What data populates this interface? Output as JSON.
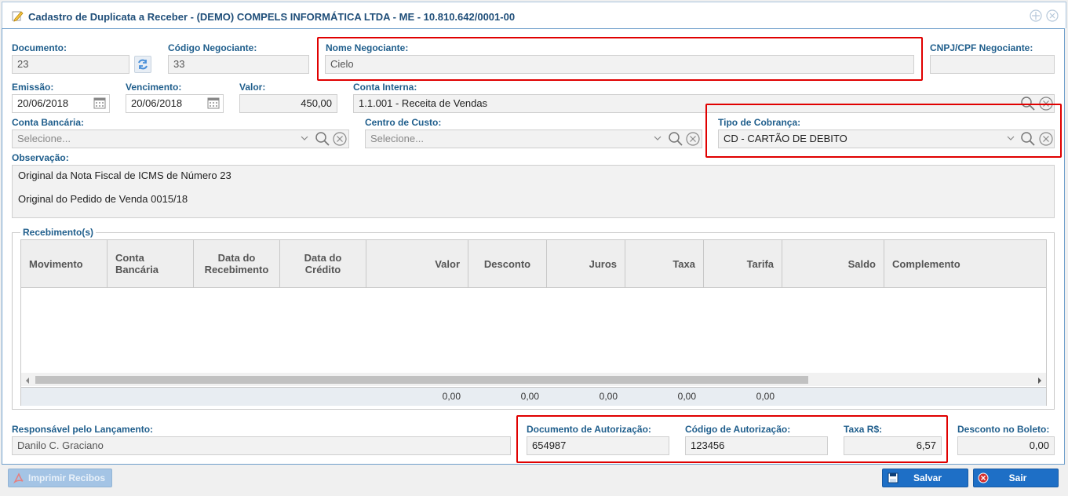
{
  "window": {
    "title": "Cadastro de Duplicata a Receber - (DEMO) COMPELS INFORMÁTICA LTDA - ME - 10.810.642/0001-00"
  },
  "form": {
    "documento": {
      "label": "Documento:",
      "value": "23"
    },
    "codigo_negociante": {
      "label": "Código Negociante:",
      "value": "33"
    },
    "nome_negociante": {
      "label": "Nome Negociante:",
      "value": "Cielo"
    },
    "cnpj_negociante": {
      "label": "CNPJ/CPF Negociante:",
      "value": ""
    },
    "emissao": {
      "label": "Emissão:",
      "value": "20/06/2018"
    },
    "vencimento": {
      "label": "Vencimento:",
      "value": "20/06/2018"
    },
    "valor": {
      "label": "Valor:",
      "value": "450,00"
    },
    "conta_interna": {
      "label": "Conta Interna:",
      "value": "1.1.001 - Receita de Vendas"
    },
    "conta_bancaria": {
      "label": "Conta Bancária:",
      "placeholder": "Selecione..."
    },
    "centro_custo": {
      "label": "Centro de Custo:",
      "placeholder": "Selecione..."
    },
    "tipo_cobranca": {
      "label": "Tipo de Cobrança:",
      "value": "CD - CARTÃO DE DEBITO"
    },
    "observacao": {
      "label": "Observação:",
      "line1": "Original da Nota Fiscal de ICMS de Número 23",
      "line2": "Original do Pedido de Venda 0015/18"
    }
  },
  "recebimentos": {
    "legend": "Recebimento(s)",
    "columns": [
      "Movimento",
      "Conta Bancária",
      "Data do Recebimento",
      "Data do Crédito",
      "Valor",
      "Desconto",
      "Juros",
      "Taxa",
      "Tarifa",
      "Saldo",
      "Complemento"
    ],
    "totals": [
      "0,00",
      "0,00",
      "0,00",
      "0,00",
      "0,00"
    ]
  },
  "bottom": {
    "responsavel": {
      "label": "Responsável pelo Lançamento:",
      "value": "Danilo C. Graciano"
    },
    "documento_autorizacao": {
      "label": "Documento de Autorização:",
      "value": "654987"
    },
    "codigo_autorizacao": {
      "label": "Código de Autorização:",
      "value": "123456"
    },
    "taxa": {
      "label": "Taxa R$:",
      "value": "6,57"
    },
    "desconto_boleto": {
      "label": "Desconto no Boleto:",
      "value": "0,00"
    }
  },
  "actions": {
    "imprimir": "Imprimir Recibos",
    "salvar": "Salvar",
    "sair": "Sair"
  },
  "colors": {
    "label": "#1f5e8c",
    "highlight": "#e00000",
    "button_blue": "#1e6fc6"
  }
}
